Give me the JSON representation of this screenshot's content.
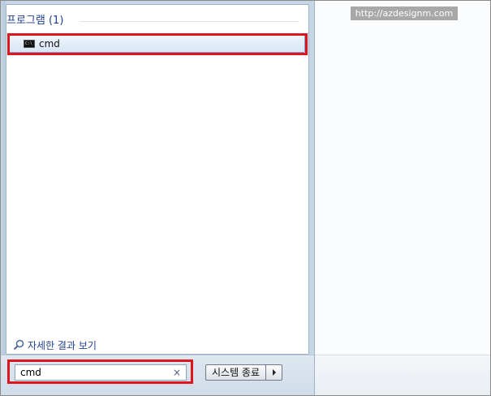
{
  "watermark": "http://azdesignm.com",
  "programs_section": {
    "title": "프로그램 (1)",
    "results": [
      {
        "label": "cmd",
        "icon": "cmd-console-icon"
      }
    ]
  },
  "more_results": {
    "label": "자세한 결과 보기",
    "icon": "magnifier-icon"
  },
  "search": {
    "value": "cmd",
    "clear_icon": "×"
  },
  "shutdown": {
    "label": "시스템 종료",
    "arrow_icon": "triangle-right-icon"
  },
  "colors": {
    "highlight": "#e0141c",
    "section_title": "#1e3f8f",
    "selected_row": "#d8e6f6"
  }
}
